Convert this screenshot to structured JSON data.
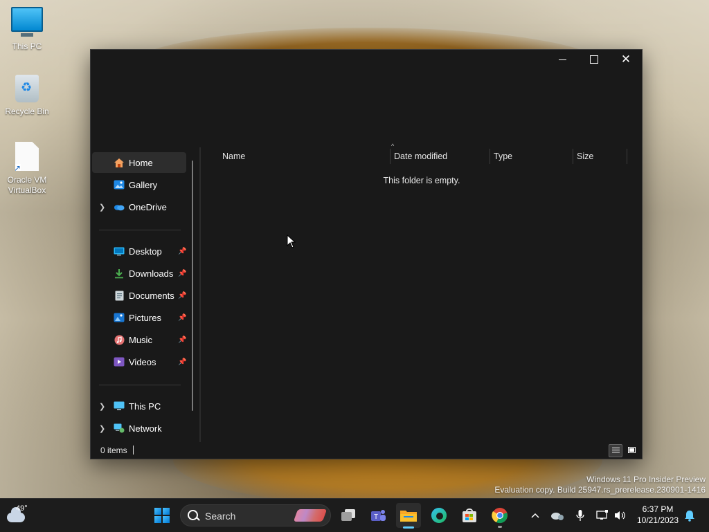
{
  "desktop": {
    "icons": [
      {
        "label": "This PC"
      },
      {
        "label": "Recycle Bin"
      },
      {
        "label": "Oracle VM VirtualBox"
      }
    ]
  },
  "window": {
    "controls": {
      "minimize": "minimize",
      "maximize": "maximize",
      "close": "✕"
    },
    "nav": {
      "items": [
        {
          "label": "Home",
          "icon": "home-icon",
          "selected": true
        },
        {
          "label": "Gallery",
          "icon": "gallery-icon"
        },
        {
          "label": "OneDrive",
          "icon": "onedrive-icon",
          "expandable": true
        },
        {
          "label": "Desktop",
          "icon": "desktop-icon",
          "pinned": true
        },
        {
          "label": "Downloads",
          "icon": "download-icon",
          "pinned": true
        },
        {
          "label": "Documents",
          "icon": "documents-icon",
          "pinned": true
        },
        {
          "label": "Pictures",
          "icon": "pictures-icon",
          "pinned": true
        },
        {
          "label": "Music",
          "icon": "music-icon",
          "pinned": true
        },
        {
          "label": "Videos",
          "icon": "videos-icon",
          "pinned": true
        },
        {
          "label": "This PC",
          "icon": "pc-icon",
          "expandable": true
        },
        {
          "label": "Network",
          "icon": "network-icon",
          "expandable": true
        }
      ]
    },
    "columns": {
      "name": "Name",
      "date": "Date modified",
      "type": "Type",
      "size": "Size"
    },
    "empty_message": "This folder is empty.",
    "status": {
      "items": "0 items"
    }
  },
  "watermark": {
    "line1": "Windows 11 Pro Insider Preview",
    "line2": "Evaluation copy. Build 25947.rs_prerelease.230901-1416"
  },
  "taskbar": {
    "weather": {
      "temp": "49°"
    },
    "search": {
      "placeholder": "Search"
    },
    "clock": {
      "time": "6:37 PM",
      "date": "10/21/2023"
    },
    "colors": {
      "accent": "#60cdff",
      "taskbar": "#1c1c1c"
    }
  }
}
